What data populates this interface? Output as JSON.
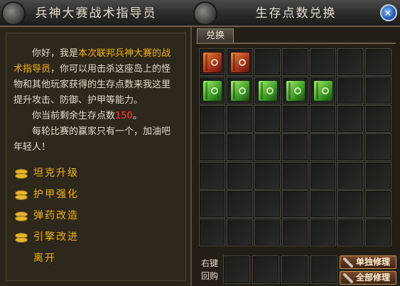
{
  "left": {
    "title": "兵神大赛战术指导员",
    "dialog": {
      "p1_a": "你好，我是",
      "p1_highlight": "本次联邦兵神大赛的战术指导员",
      "p1_b": "，你可以用击杀这座岛上的怪物和其他玩家获得的生存点数来我这里提升攻击、防御、护甲等能力。",
      "p2_a": "你当前剩余生存点数",
      "p2_points": "150",
      "p2_b": "。",
      "p3": "每轮比赛的赢家只有一个，加油吧年轻人！"
    },
    "options": [
      {
        "label": "坦克升级",
        "icon": "gold-coins-icon"
      },
      {
        "label": "护甲强化",
        "icon": "gold-coins-icon"
      },
      {
        "label": "弹药改造",
        "icon": "gold-coins-icon"
      },
      {
        "label": "引擎改进",
        "icon": "gold-coins-icon"
      }
    ],
    "leave": "离开"
  },
  "right": {
    "title": "生存点数兑换",
    "tab": "兑换",
    "items": [
      {
        "row": 0,
        "col": 0,
        "kind": "red-book-icon"
      },
      {
        "row": 0,
        "col": 1,
        "kind": "red-book-icon"
      },
      {
        "row": 1,
        "col": 0,
        "kind": "green-book-icon"
      },
      {
        "row": 1,
        "col": 1,
        "kind": "green-book-icon"
      },
      {
        "row": 1,
        "col": 2,
        "kind": "green-book-icon"
      },
      {
        "row": 1,
        "col": 3,
        "kind": "green-book-icon"
      },
      {
        "row": 1,
        "col": 4,
        "kind": "green-book-icon"
      }
    ],
    "buyback_label": "右键回购",
    "repair_single": "单独修理",
    "repair_all": "全部修理"
  },
  "colors": {
    "highlight": "#f0b400",
    "points": "#ff3b30"
  }
}
